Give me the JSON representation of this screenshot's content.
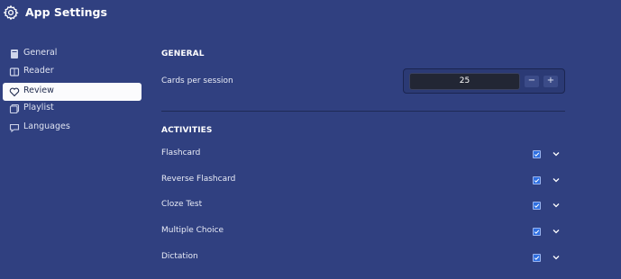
{
  "app": {
    "title": "App Settings",
    "icon": "gear-icon"
  },
  "sidebar": {
    "items": [
      {
        "label": "General",
        "icon": "book-icon",
        "active": false
      },
      {
        "label": "Reader",
        "icon": "reader-icon",
        "active": false
      },
      {
        "label": "Review",
        "icon": "heart-icon",
        "active": true
      },
      {
        "label": "Playlist",
        "icon": "playlist-icon",
        "active": false
      },
      {
        "label": "Languages",
        "icon": "chat-icon",
        "active": false
      }
    ]
  },
  "general": {
    "title": "GENERAL",
    "cards_label": "Cards per session",
    "cards_value": "25",
    "decrement_label": "−",
    "increment_label": "+"
  },
  "activities": {
    "title": "ACTIVITIES",
    "items": [
      {
        "label": "Flashcard",
        "checked": true
      },
      {
        "label": "Reverse Flashcard",
        "checked": true
      },
      {
        "label": "Cloze Test",
        "checked": true
      },
      {
        "label": "Multiple Choice",
        "checked": true
      },
      {
        "label": "Dictation",
        "checked": true
      }
    ]
  },
  "colors": {
    "background": "#304080",
    "active_item": "#fbfbfd",
    "checkbox": "#2f6fe0"
  }
}
